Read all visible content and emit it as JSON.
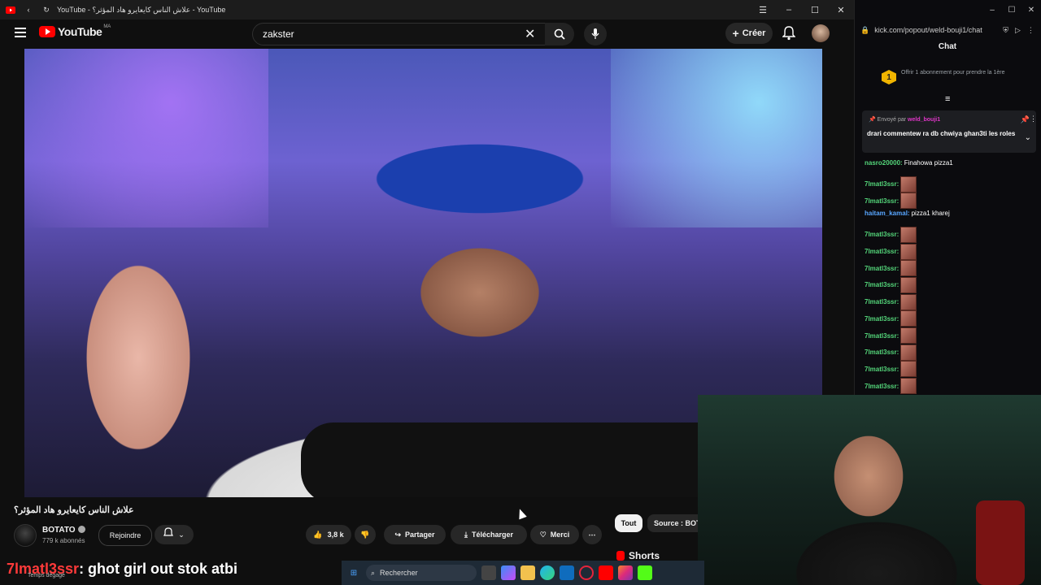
{
  "browser": {
    "title": "YouTube - علاش الناس كايعايرو هاد المؤثر؟ - YouTube"
  },
  "youtube": {
    "logo_text": "YouTube",
    "region": "MA",
    "search_value": "zakster",
    "create_label": "Créer"
  },
  "video": {
    "title": "علاش الناس كايعايرو هاد المؤثر؟",
    "channel": "BOTATO",
    "subscribers": "779 k abonnés",
    "join_label": "Rejoindre",
    "likes": "3,8 k",
    "share_label": "Partager",
    "download_label": "Télécharger",
    "thanks_label": "Merci"
  },
  "sidebar": {
    "chips": [
      "Tout",
      "Source : BOTATO"
    ],
    "shorts_label": "Shorts"
  },
  "chat": {
    "url": "kick.com/popout/weld-bouji1/chat",
    "header": "Chat",
    "promo": "Offrir 1 abonnement pour prendre la 1ère",
    "pinned_sender_prefix": "Envoyé par",
    "pinned_sender": "weld_bouji1",
    "pinned_message": "drari commentew ra db chwiya ghan3ti les roles",
    "messages": [
      {
        "user": "nasro20000:",
        "text": "Finahowa pizza1",
        "emote": false,
        "color": "green"
      },
      {
        "user": "7lmatl3ssr:",
        "text": "",
        "emote": true,
        "color": "green"
      },
      {
        "user": "7lmatl3ssr:",
        "text": "",
        "emote": true,
        "color": "green"
      },
      {
        "user": "haitam_kamal:",
        "text": "pizza1 kharej",
        "emote": false,
        "color": "blue"
      },
      {
        "user": "7lmatl3ssr:",
        "text": "",
        "emote": true,
        "color": "green"
      },
      {
        "user": "7lmatl3ssr:",
        "text": "",
        "emote": true,
        "color": "green"
      },
      {
        "user": "7lmatl3ssr:",
        "text": "",
        "emote": true,
        "color": "green"
      },
      {
        "user": "7lmatl3ssr:",
        "text": "",
        "emote": true,
        "color": "green"
      },
      {
        "user": "7lmatl3ssr:",
        "text": "",
        "emote": true,
        "color": "green"
      },
      {
        "user": "7lmatl3ssr:",
        "text": "",
        "emote": true,
        "color": "green"
      },
      {
        "user": "7lmatl3ssr:",
        "text": "",
        "emote": true,
        "color": "green"
      },
      {
        "user": "7lmatl3ssr:",
        "text": "",
        "emote": true,
        "color": "green"
      },
      {
        "user": "7lmatl3ssr:",
        "text": "",
        "emote": true,
        "color": "green"
      },
      {
        "user": "7lmatl3ssr:",
        "text": "",
        "emote": true,
        "color": "green"
      }
    ]
  },
  "overlay": {
    "caption_name": "7lmatl3ssr",
    "caption_message": ": ghot girl out stok atbi",
    "caption_sub": "Temps dégagé"
  },
  "taskbar": {
    "search_label": "Rechercher"
  },
  "colors": {
    "youtube_red": "#ff0000",
    "chat_user_green": "#54d67a",
    "chat_user_blue": "#58a6ff",
    "caption_red": "#ff3a3a"
  }
}
